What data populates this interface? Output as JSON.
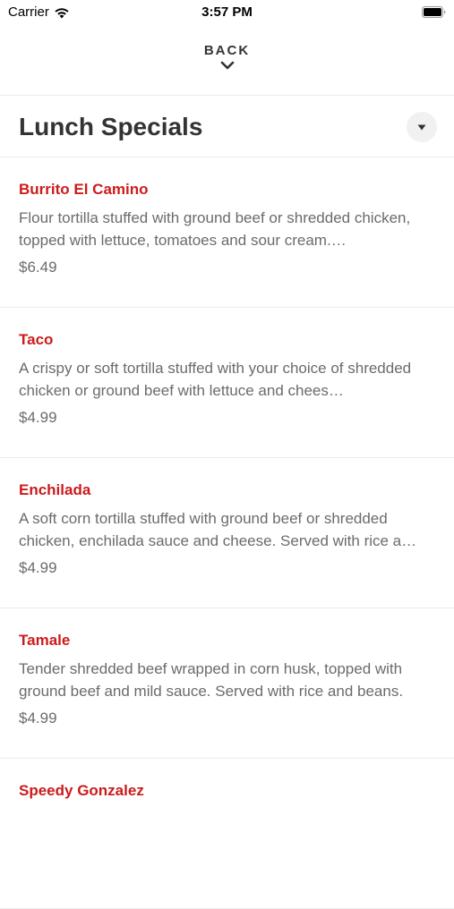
{
  "status_bar": {
    "carrier": "Carrier",
    "time": "3:57 PM"
  },
  "header": {
    "back_label": "BACK"
  },
  "section": {
    "title": "Lunch Specials"
  },
  "colors": {
    "item_name": "#cc1b1b",
    "body_text": "#6b6b6b",
    "title_text": "#333333"
  },
  "items": [
    {
      "name": "Burrito El Camino",
      "description": "Flour tortilla stuffed with ground beef or shredded chicken, topped with lettuce, tomatoes and sour cream.…",
      "price": "$6.49"
    },
    {
      "name": "Taco",
      "description": "A crispy or soft tortilla stuffed with your choice of shredded chicken or ground beef with lettuce and chees…",
      "price": "$4.99"
    },
    {
      "name": "Enchilada",
      "description": "A soft corn tortilla stuffed with ground beef or shredded chicken, enchilada sauce and cheese. Served with rice a…",
      "price": "$4.99"
    },
    {
      "name": "Tamale",
      "description": "Tender shredded beef wrapped in corn husk, topped with ground beef and mild sauce. Served with rice and beans.",
      "price": "$4.99"
    },
    {
      "name": "Speedy Gonzalez",
      "description": "",
      "price": ""
    }
  ]
}
